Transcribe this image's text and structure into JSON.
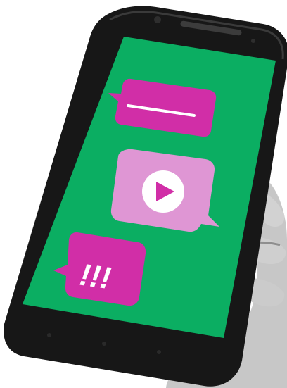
{
  "scene": {
    "subject": "hand-holding-smartphone",
    "photo_style": "grayscale",
    "screen": {
      "background_color": "#0bae62"
    },
    "bubbles": [
      {
        "kind": "text-message-bubble",
        "color": "#d12ea7"
      },
      {
        "kind": "video-play-bubble",
        "color": "#df96d4",
        "play_button_fill": "#ffffff",
        "play_triangle_color": "#d12ea7"
      },
      {
        "kind": "alert-bubble",
        "color": "#d12ea7",
        "glyph": "!!!"
      }
    ]
  }
}
